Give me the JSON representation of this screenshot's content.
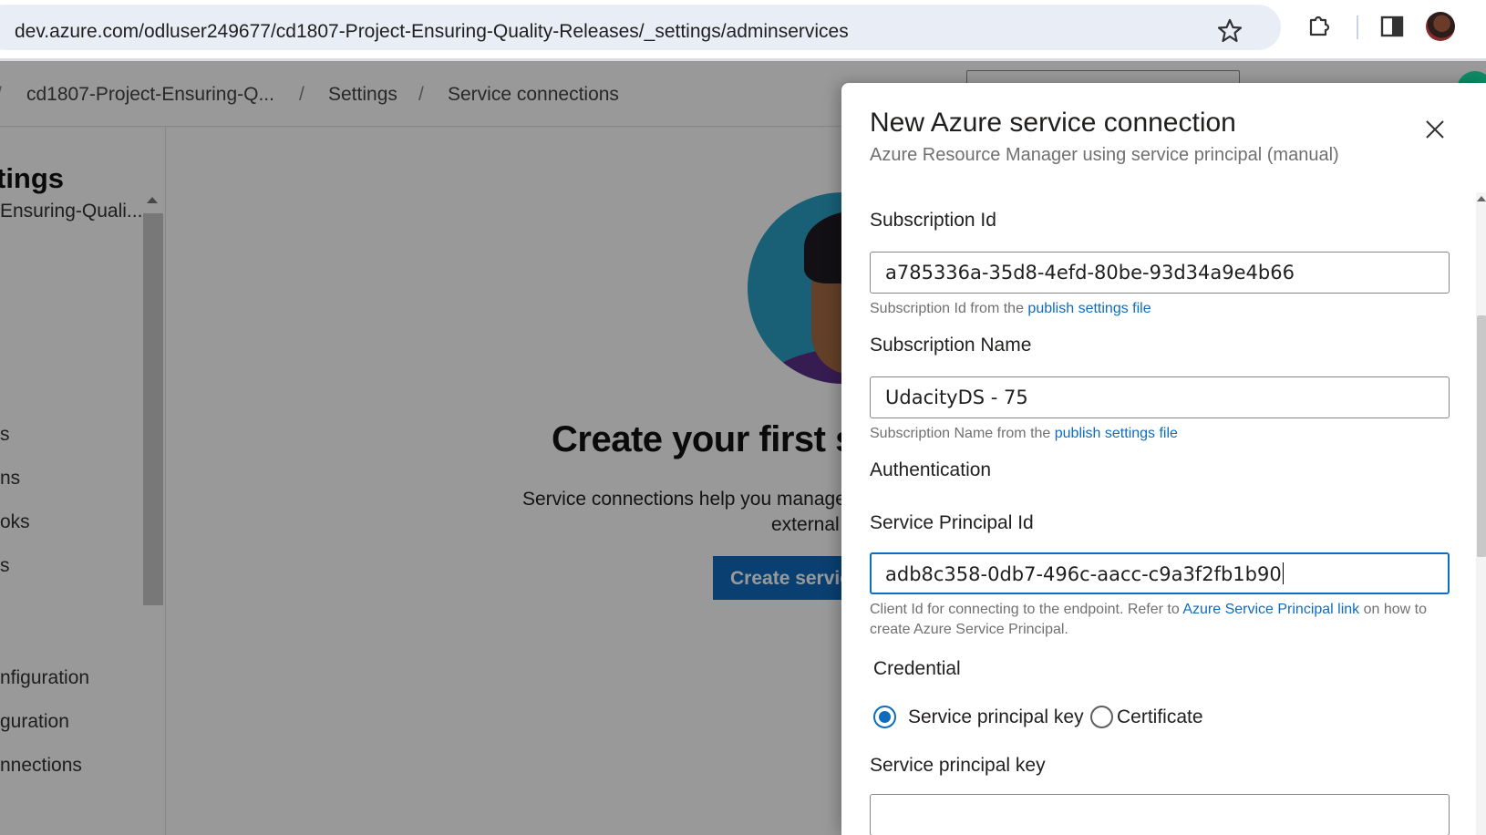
{
  "browser": {
    "url": "dev.azure.com/odluser249677/cd1807-Project-Ensuring-Quality-Releases/_settings/adminservices",
    "icons": [
      "site-settings-icon",
      "bookmark-star-icon",
      "extensions-icon",
      "side-panel-icon",
      "profile-avatar"
    ]
  },
  "breadcrumb": {
    "items": [
      "cd1807-Project-Ensuring-Q...",
      "Settings",
      "Service connections"
    ],
    "separator": "/"
  },
  "sidebar": {
    "title": "tings",
    "subtitle": "Ensuring-Quali...",
    "items": [
      "s",
      "ns",
      "oks",
      "s",
      "nfiguration",
      "guration",
      "nnections"
    ]
  },
  "main": {
    "title": "Create your first s",
    "description_line1": "Service connections help you manage",
    "description_line2": "external",
    "button_label": "Create servic"
  },
  "panel": {
    "title": "New Azure service connection",
    "subtitle": "Azure Resource Manager using service principal (manual)",
    "subscription_id": {
      "label": "Subscription Id",
      "value": "a785336a-35d8-4efd-80be-93d34a9e4b66",
      "help": "Subscription Id from the ",
      "help_link": "publish settings file"
    },
    "subscription_name": {
      "label": "Subscription Name",
      "value": "UdacityDS - 75",
      "help": "Subscription Name from the ",
      "help_link": "publish settings file"
    },
    "authentication_heading": "Authentication",
    "service_principal_id": {
      "label": "Service Principal Id",
      "value": "adb8c358-0db7-496c-aacc-c9a3f2fb1b90",
      "help_pre": "Client Id for connecting to the endpoint. Refer to ",
      "help_link": "Azure Service Principal link",
      "help_post": " on how to create Azure Service Principal."
    },
    "credential": {
      "label": "Credential",
      "options": [
        "Service principal key",
        "Certificate"
      ],
      "selected": "Service principal key"
    },
    "service_principal_key": {
      "label": "Service principal key",
      "value": ""
    }
  },
  "colors": {
    "accent": "#0f6cbd",
    "overlay": "rgba(0,0,0,0.40)",
    "hero_circle": "#2aa1c5"
  }
}
